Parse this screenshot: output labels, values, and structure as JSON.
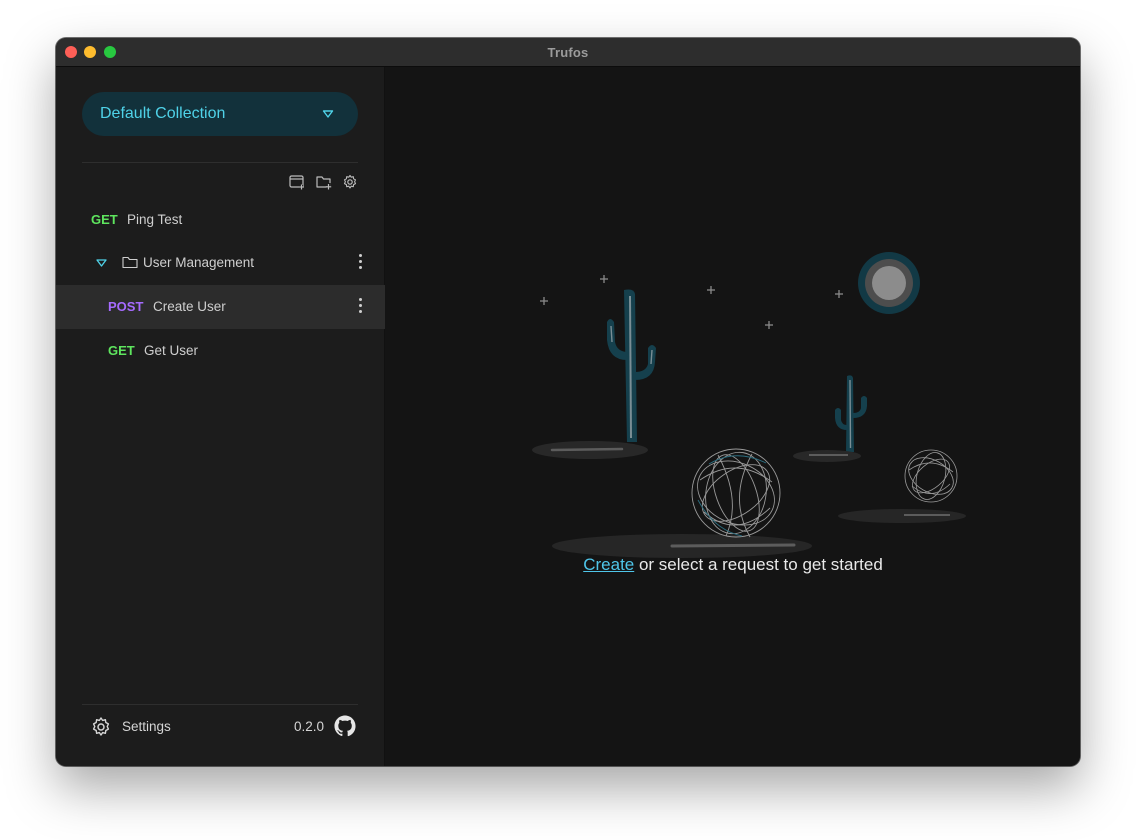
{
  "window": {
    "title": "Trufos"
  },
  "sidebar": {
    "collection": {
      "selected": "Default Collection"
    },
    "toolbar": [
      {
        "icon": "new-request-icon"
      },
      {
        "icon": "new-folder-icon"
      },
      {
        "icon": "collection-settings-icon"
      }
    ],
    "items": [
      {
        "type": "request",
        "method": "GET",
        "label": "Ping Test"
      },
      {
        "type": "folder",
        "label": "User Management",
        "expanded": true
      },
      {
        "type": "request",
        "method": "POST",
        "label": "Create User",
        "selected": true
      },
      {
        "type": "request",
        "method": "GET",
        "label": "Get User"
      }
    ],
    "footer": {
      "settings_label": "Settings",
      "version": "0.2.0",
      "github_icon": "github-icon"
    }
  },
  "main": {
    "empty_state": {
      "link_text": "Create",
      "rest_text": " or select a request to get started"
    }
  },
  "colors": {
    "accent": "#4fd2e8",
    "get": "#5ee55e",
    "post": "#a66bff",
    "collection_bg": "#12313b"
  }
}
